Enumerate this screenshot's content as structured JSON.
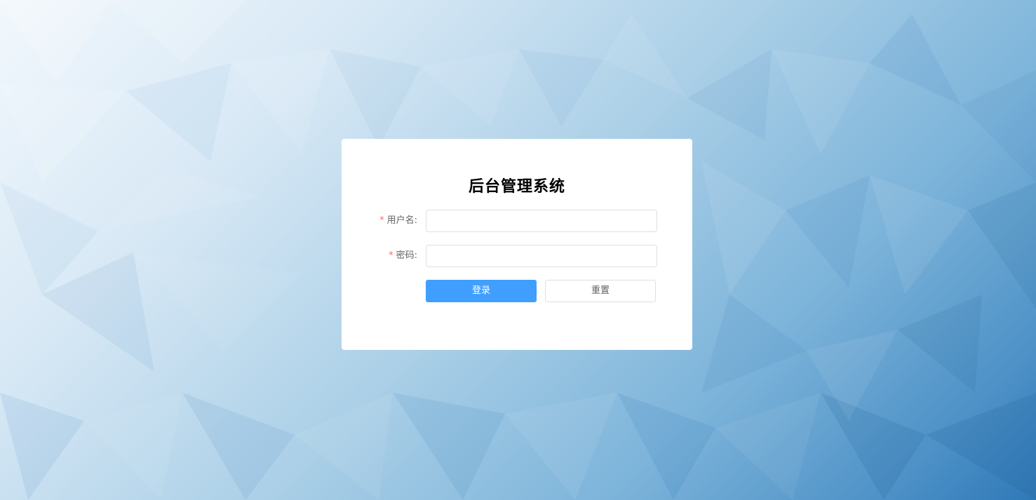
{
  "page": {
    "background_colors": [
      "#f2f8fd",
      "#d7e8f5",
      "#aacfe7",
      "#7db4da",
      "#4d91c7",
      "#2f79b8"
    ]
  },
  "login": {
    "title": "后台管理系统",
    "username": {
      "label": "用户名:",
      "required_mark": "*",
      "value": "",
      "placeholder": ""
    },
    "password": {
      "label": "密码:",
      "required_mark": "*",
      "value": "",
      "placeholder": ""
    },
    "buttons": {
      "login_label": "登录",
      "reset_label": "重置"
    }
  },
  "colors": {
    "primary": "#409eff",
    "required": "#f56c6c",
    "label_text": "#606266",
    "border": "#dcdfe6"
  }
}
